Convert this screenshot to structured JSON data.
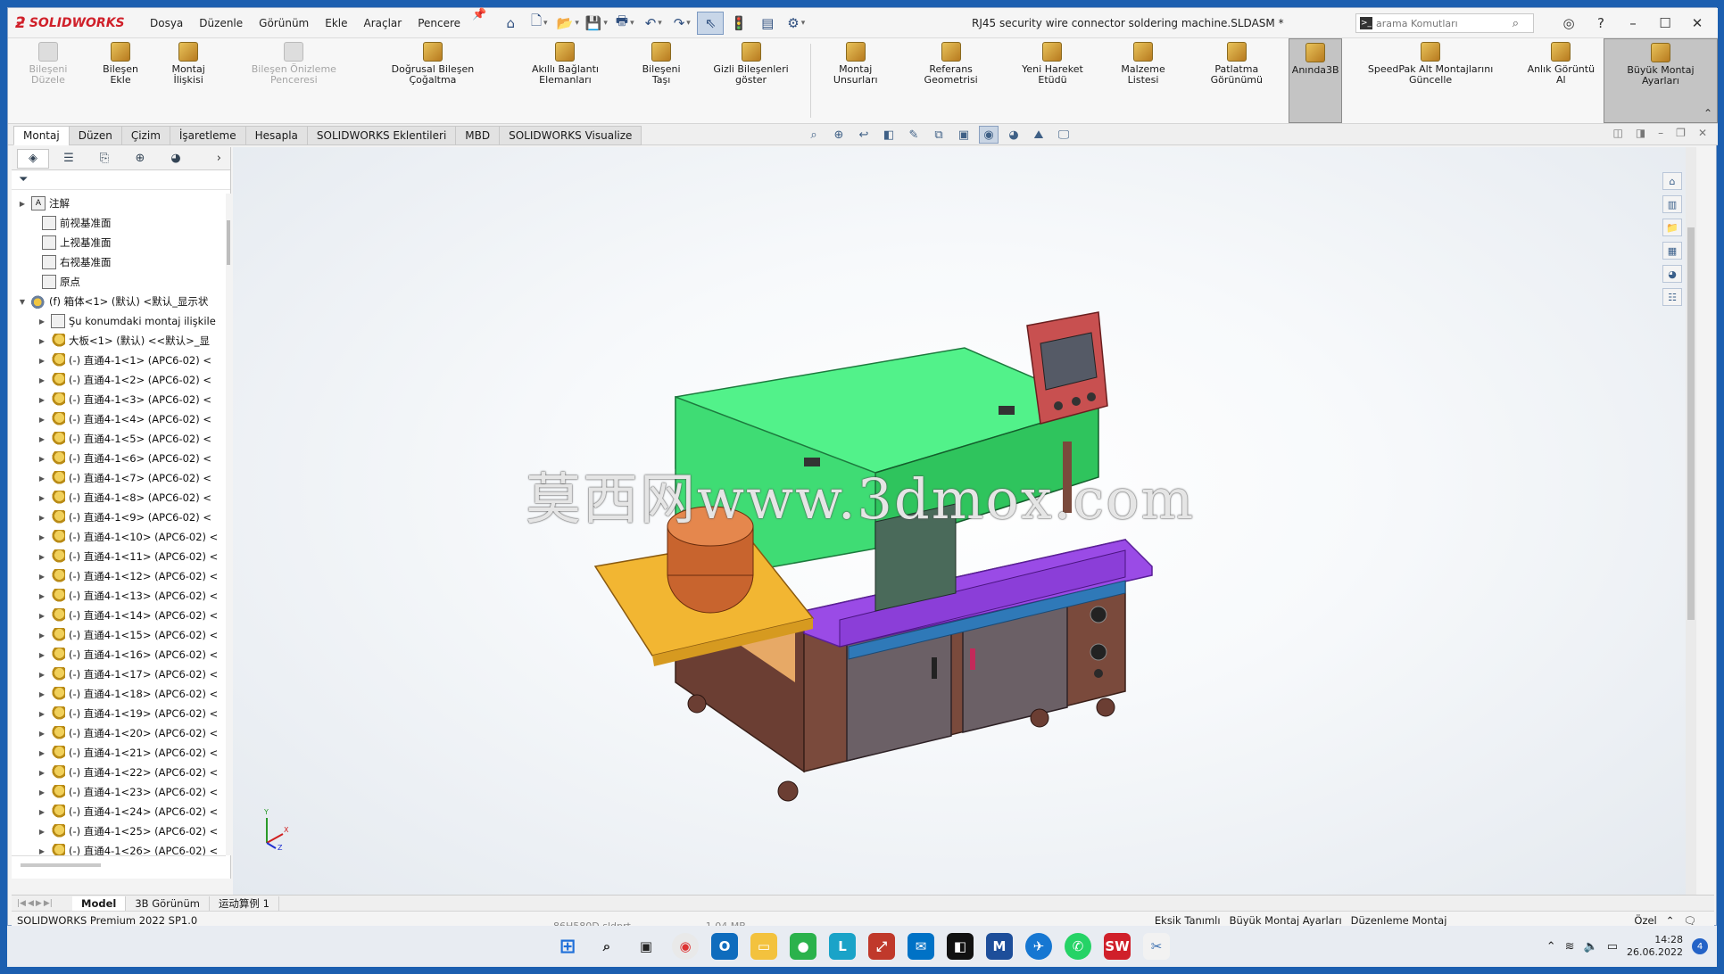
{
  "app": {
    "brand": "SOLIDWORKS",
    "document_title": "RJ45 security wire connector soldering machine.SLDASM *"
  },
  "menu": [
    "Dosya",
    "Düzenle",
    "Görünüm",
    "Ekle",
    "Araçlar",
    "Pencere"
  ],
  "search": {
    "placeholder": "arama Komutları"
  },
  "ribbon": [
    {
      "label": "Bileşeni Düzele",
      "disabled": true
    },
    {
      "label": "Bileşen Ekle",
      "disabled": false
    },
    {
      "label": "Montaj İlişkisi",
      "disabled": false
    },
    {
      "label": "Bileşen Önizleme Penceresi",
      "disabled": true
    },
    {
      "label": "Doğrusal Bileşen Çoğaltma",
      "disabled": false
    },
    {
      "label": "Akıllı Bağlantı Elemanları",
      "disabled": false
    },
    {
      "label": "Bileşeni Taşı",
      "disabled": false
    },
    {
      "label": "Gizli Bileşenleri göster",
      "disabled": false
    },
    {
      "label": "Montaj Unsurları",
      "disabled": false
    },
    {
      "label": "Referans Geometrisi",
      "disabled": false
    },
    {
      "label": "Yeni Hareket Etüdü",
      "disabled": false
    },
    {
      "label": "Malzeme Listesi",
      "disabled": false
    },
    {
      "label": "Patlatma Görünümü",
      "disabled": false
    },
    {
      "label": "Anında3B",
      "disabled": false,
      "selected": true
    },
    {
      "label": "SpeedPak Alt Montajlarını Güncelle",
      "disabled": false
    },
    {
      "label": "Anlık Görüntü Al",
      "disabled": false
    },
    {
      "label": "Büyük Montaj Ayarları",
      "disabled": false,
      "selected": true
    }
  ],
  "tabs": [
    "Montaj",
    "Düzen",
    "Çizim",
    "İşaretleme",
    "Hesapla",
    "SOLIDWORKS Eklentileri",
    "MBD",
    "SOLIDWORKS Visualize"
  ],
  "tree": [
    {
      "label": "注解",
      "type": "folder",
      "exp": "▶"
    },
    {
      "label": "前视基准面",
      "type": "plane",
      "exp": ""
    },
    {
      "label": "上视基准面",
      "type": "plane",
      "exp": ""
    },
    {
      "label": "右视基准面",
      "type": "plane",
      "exp": ""
    },
    {
      "label": "原点",
      "type": "origin",
      "exp": ""
    },
    {
      "label": "(f) 箱体<1> (默认) <默认_显示状",
      "type": "asm",
      "exp": "▼"
    },
    {
      "label": "Şu konumdaki montaj ilişkile",
      "type": "mate",
      "exp": "▶"
    },
    {
      "label": "大板<1> (默认) <<默认>_显",
      "type": "part",
      "exp": "▶"
    },
    {
      "label": "(-) 直通4-1<1> (APC6-02) <",
      "type": "part",
      "exp": "▶"
    },
    {
      "label": "(-) 直通4-1<2> (APC6-02) <",
      "type": "part",
      "exp": "▶"
    },
    {
      "label": "(-) 直通4-1<3> (APC6-02) <",
      "type": "part",
      "exp": "▶"
    },
    {
      "label": "(-) 直通4-1<4> (APC6-02) <",
      "type": "part",
      "exp": "▶"
    },
    {
      "label": "(-) 直通4-1<5> (APC6-02) <",
      "type": "part",
      "exp": "▶"
    },
    {
      "label": "(-) 直通4-1<6> (APC6-02) <",
      "type": "part",
      "exp": "▶"
    },
    {
      "label": "(-) 直通4-1<7> (APC6-02) <",
      "type": "part",
      "exp": "▶"
    },
    {
      "label": "(-) 直通4-1<8> (APC6-02) <",
      "type": "part",
      "exp": "▶"
    },
    {
      "label": "(-) 直通4-1<9> (APC6-02) <",
      "type": "part",
      "exp": "▶"
    },
    {
      "label": "(-) 直通4-1<10> (APC6-02) <",
      "type": "part",
      "exp": "▶"
    },
    {
      "label": "(-) 直通4-1<11> (APC6-02) <",
      "type": "part",
      "exp": "▶"
    },
    {
      "label": "(-) 直通4-1<12> (APC6-02) <",
      "type": "part",
      "exp": "▶"
    },
    {
      "label": "(-) 直通4-1<13> (APC6-02) <",
      "type": "part",
      "exp": "▶"
    },
    {
      "label": "(-) 直通4-1<14> (APC6-02) <",
      "type": "part",
      "exp": "▶"
    },
    {
      "label": "(-) 直通4-1<15> (APC6-02) <",
      "type": "part",
      "exp": "▶"
    },
    {
      "label": "(-) 直通4-1<16> (APC6-02) <",
      "type": "part",
      "exp": "▶"
    },
    {
      "label": "(-) 直通4-1<17> (APC6-02) <",
      "type": "part",
      "exp": "▶"
    },
    {
      "label": "(-) 直通4-1<18> (APC6-02) <",
      "type": "part",
      "exp": "▶"
    },
    {
      "label": "(-) 直通4-1<19> (APC6-02) <",
      "type": "part",
      "exp": "▶"
    },
    {
      "label": "(-) 直通4-1<20> (APC6-02) <",
      "type": "part",
      "exp": "▶"
    },
    {
      "label": "(-) 直通4-1<21> (APC6-02) <",
      "type": "part",
      "exp": "▶"
    },
    {
      "label": "(-) 直通4-1<22> (APC6-02) <",
      "type": "part",
      "exp": "▶"
    },
    {
      "label": "(-) 直通4-1<23> (APC6-02) <",
      "type": "part",
      "exp": "▶"
    },
    {
      "label": "(-) 直通4-1<24> (APC6-02) <",
      "type": "part",
      "exp": "▶"
    },
    {
      "label": "(-) 直通4-1<25> (APC6-02) <",
      "type": "part",
      "exp": "▶"
    },
    {
      "label": "(-) 直通4-1<26> (APC6-02) <",
      "type": "part",
      "exp": "▶"
    }
  ],
  "viewport": {
    "watermark": "莫西网www.3dmox.com",
    "triad": {
      "y": "Y",
      "x": "X",
      "z": "Z"
    }
  },
  "bottom_tabs": [
    "Model",
    "3B Görünüm",
    "运动算例 1"
  ],
  "status": {
    "product": "SOLIDWORKS Premium 2022 SP1.0",
    "definition": "Eksik Tanımlı",
    "mode": "Büyük Montaj Ayarları",
    "editing": "Düzenleme Montaj",
    "units": "Özel"
  },
  "behind_strip": {
    "file": "86H580D.sldprt",
    "size": "1,04 MB"
  },
  "taskbar": {
    "time": "14:28",
    "date": "26.06.2022",
    "notification_count": "4"
  },
  "colors": {
    "brand_red": "#d0202a",
    "machine_green": "#48e07a",
    "machine_purple": "#9a4be6",
    "machine_brown": "#7a4a3c",
    "tray_yellow": "#f2b632"
  }
}
